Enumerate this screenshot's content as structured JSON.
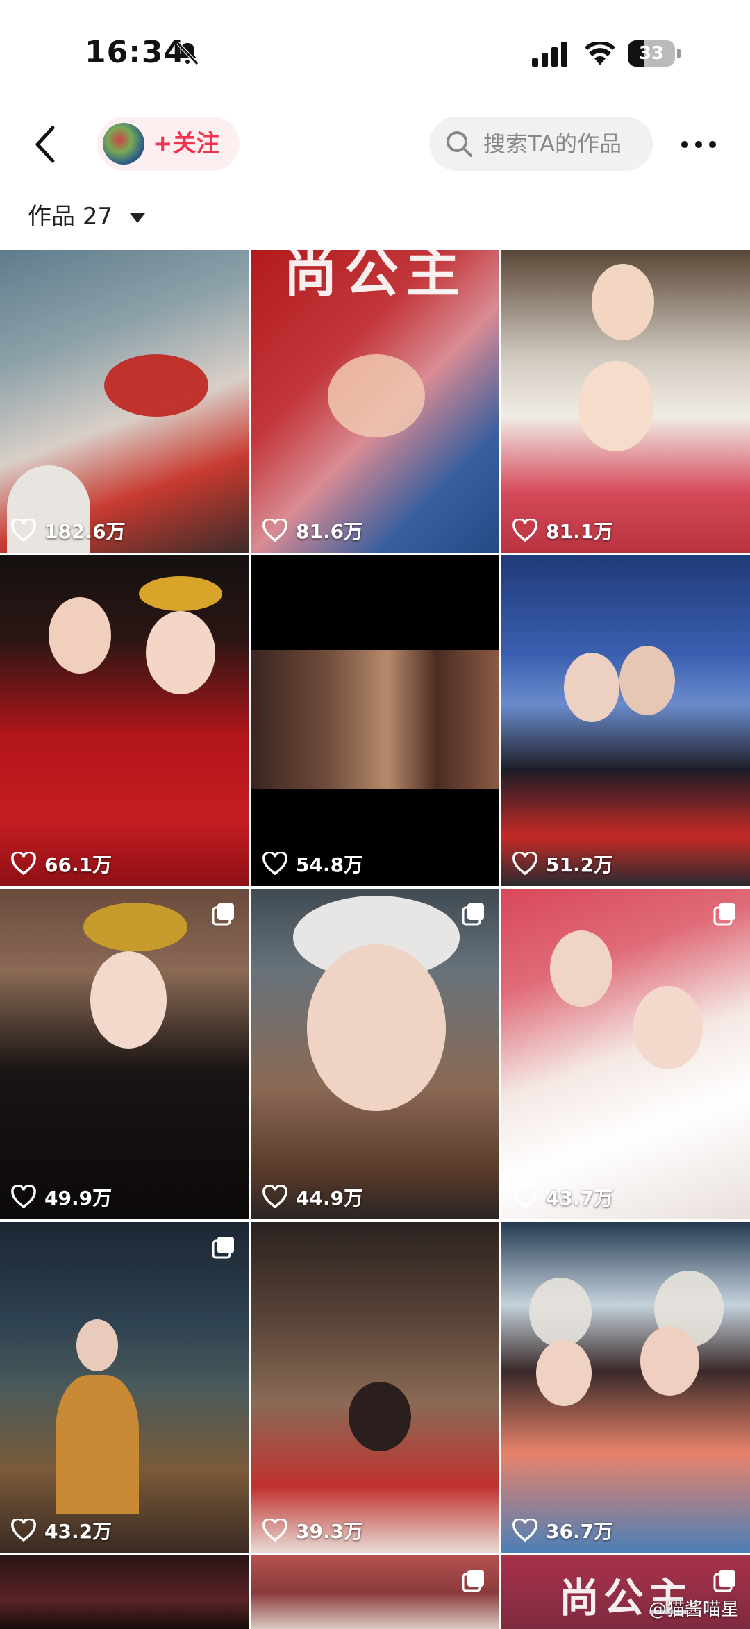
{
  "status_bar": {
    "time": "16:34",
    "battery": "33"
  },
  "nav": {
    "follow_label": "+关注",
    "search_placeholder": "搜索TA的作品"
  },
  "works": {
    "label": "作品",
    "count": "27"
  },
  "poster_title": "尚公主",
  "tiles": [
    {
      "likes": "182.6万",
      "multi": false
    },
    {
      "likes": "81.6万",
      "multi": false
    },
    {
      "likes": "81.1万",
      "multi": false
    },
    {
      "likes": "66.1万",
      "multi": false
    },
    {
      "likes": "54.8万",
      "multi": false
    },
    {
      "likes": "51.2万",
      "multi": false
    },
    {
      "likes": "49.9万",
      "multi": true
    },
    {
      "likes": "44.9万",
      "multi": true
    },
    {
      "likes": "43.7万",
      "multi": true
    },
    {
      "likes": "43.2万",
      "multi": true
    },
    {
      "likes": "39.3万",
      "multi": false
    },
    {
      "likes": "36.7万",
      "multi": false
    },
    {
      "likes": "",
      "multi": false
    },
    {
      "likes": "",
      "multi": true
    },
    {
      "likes": "",
      "multi": true
    }
  ],
  "watermark": "@猫酱喵星"
}
